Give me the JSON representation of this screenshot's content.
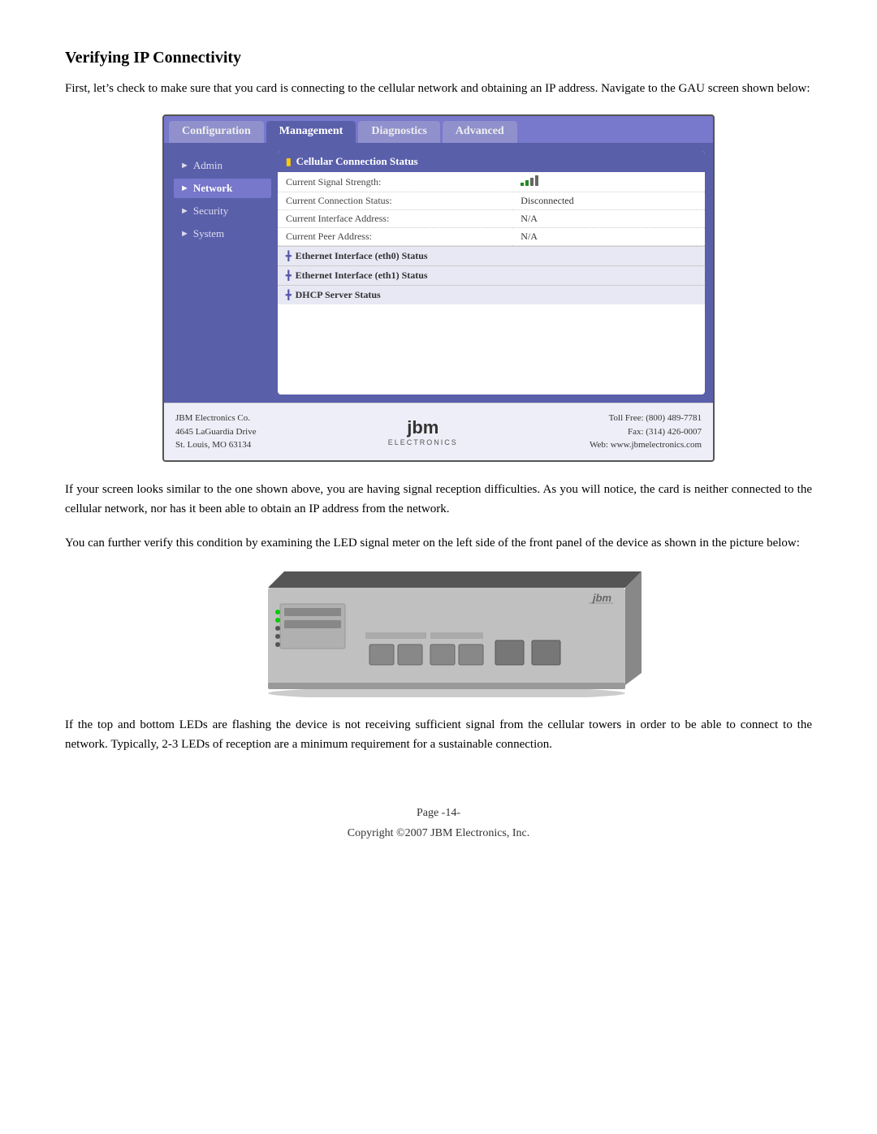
{
  "page": {
    "title": "Verifying IP Connectivity",
    "intro_text": "First, let’s check to make sure that you card is connecting to the cellular network and obtaining an IP address.  Navigate to the GAU screen shown below:",
    "para2": "If your screen looks similar to the one shown above, you are having signal reception difficulties.  As you will notice, the card is neither connected to the cellular network, nor has it been able to obtain an IP address from the network.",
    "para3": "You can further verify this condition by examining the LED signal meter on the left side of the front panel of the device as shown in the picture below:",
    "para4": "If the top and bottom LEDs are flashing the device is not receiving sufficient signal from the cellular towers in order to be able to connect to the network.  Typically, 2-3 LEDs of reception are a minimum requirement for a sustainable connection.",
    "footer_page": "Page -14-",
    "footer_copy": "Copyright ©2007 JBM Electronics, Inc."
  },
  "nav_tabs": [
    {
      "label": "Configuration",
      "active": false
    },
    {
      "label": "Management",
      "active": true
    },
    {
      "label": "Diagnostics",
      "active": false
    },
    {
      "label": "Advanced",
      "active": false
    }
  ],
  "sidebar": {
    "items": [
      {
        "label": "Admin",
        "active": false
      },
      {
        "label": "Network",
        "active": true
      },
      {
        "label": "Security",
        "active": false
      },
      {
        "label": "System",
        "active": false
      }
    ]
  },
  "cellular_status": {
    "heading": "Cellular Connection Status",
    "rows": [
      {
        "label": "Current Signal Strength:",
        "value": "bars"
      },
      {
        "label": "Current Connection Status:",
        "value": "Disconnected"
      },
      {
        "label": "Current Interface Address:",
        "value": "N/A"
      },
      {
        "label": "Current Peer Address:",
        "value": "N/A"
      }
    ]
  },
  "sub_sections": [
    {
      "label": "Ethernet Interface (eth0) Status"
    },
    {
      "label": "Ethernet Interface (eth1) Status"
    },
    {
      "label": "DHCP Server Status"
    }
  ],
  "screenshot_footer": {
    "company": "JBM Electronics Co.",
    "address1": "4645 LaGuardia Drive",
    "address2": "St. Louis, MO 63134",
    "logo_text": "jbm",
    "logo_sub": "ELECTRONICS",
    "toll_free": "Toll Free: (800) 489-7781",
    "fax": "Fax: (314) 426-0007",
    "web": "Web: www.jbmelectronics.com"
  }
}
